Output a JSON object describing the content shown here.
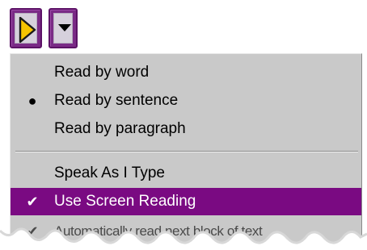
{
  "toolbar": {
    "play_button": {
      "icon": "play-icon",
      "icon_color": "#f5c400"
    },
    "dropdown_button": {
      "icon": "chevron-down-icon"
    }
  },
  "menu": {
    "items": [
      {
        "label": "Read by word",
        "mark": ""
      },
      {
        "label": "Read by sentence",
        "mark": "●"
      },
      {
        "label": "Read by paragraph",
        "mark": ""
      },
      {
        "label": "Speak As I Type",
        "mark": ""
      },
      {
        "label": "Use Screen Reading",
        "mark": "✔",
        "selected": true
      },
      {
        "label": "Automatically read next block of text",
        "mark": "✔"
      }
    ]
  },
  "colors": {
    "accent": "#7a0a82",
    "menu_background": "#c9c9c9",
    "button_frame": "#7a2a86"
  }
}
